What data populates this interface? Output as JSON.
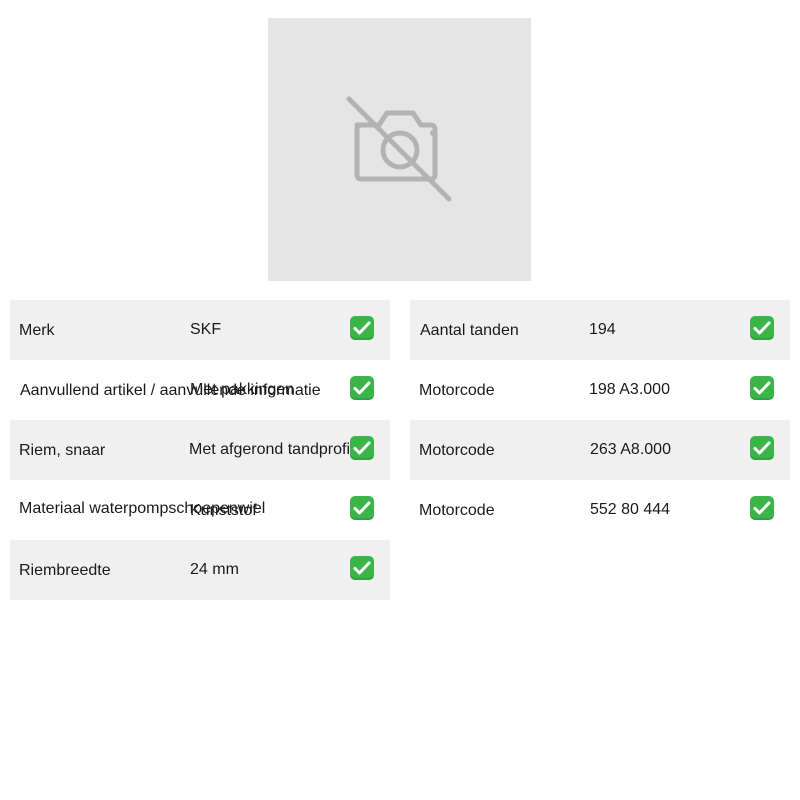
{
  "image": {
    "icon": "no-camera-icon",
    "background": "#e5e5e5"
  },
  "left_specs": [
    {
      "label": "Merk",
      "value": "SKF",
      "icon": "check-mark-icon"
    },
    {
      "label": "Aanvullend artikel / aanvullende informatie",
      "value": "Met pakkingen",
      "icon": "check-mark-icon"
    },
    {
      "label": "Riem, snaar",
      "value": "Met afgerond tandprofiel",
      "icon": "check-mark-icon"
    },
    {
      "label": "Materiaal waterpompschoepenwiel",
      "value": "Kunststof",
      "icon": "check-mark-icon"
    },
    {
      "label": "Riembreedte",
      "value": "24 mm",
      "icon": "check-mark-icon"
    }
  ],
  "right_specs": [
    {
      "label": "Aantal tanden",
      "value": "194",
      "icon": "check-mark-icon"
    },
    {
      "label": "Motorcode",
      "value": "198 A3.000",
      "icon": "check-mark-icon"
    },
    {
      "label": "Motorcode",
      "value": "263 A8.000",
      "icon": "check-mark-icon"
    },
    {
      "label": "Motorcode",
      "value": "552 80 444",
      "icon": "check-mark-icon"
    }
  ],
  "colors": {
    "row_shade": "#f0f0f0",
    "check_green": "#3bb54a"
  }
}
